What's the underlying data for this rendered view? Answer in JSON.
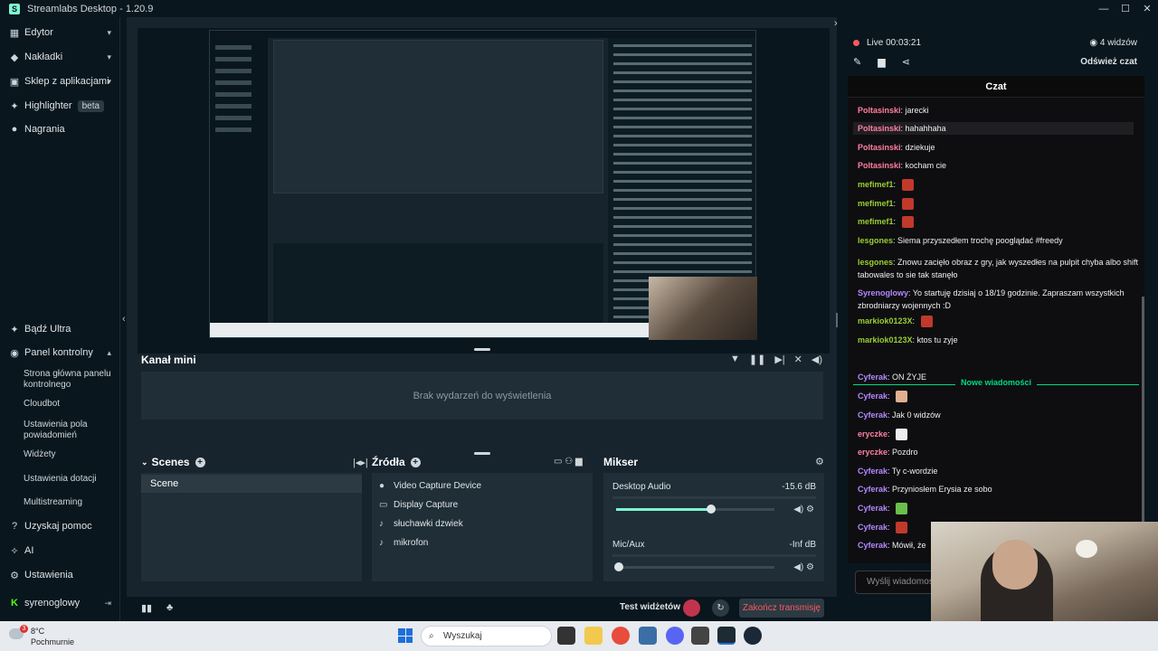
{
  "window": {
    "title": "Streamlabs Desktop - 1.20.9",
    "controls": [
      "—",
      "☐",
      "✕"
    ]
  },
  "sidebar": {
    "items": [
      {
        "label": "Edytor",
        "icon": "layout-icon",
        "glyph": "▦"
      },
      {
        "label": "Nakładki",
        "icon": "overlays-icon",
        "glyph": "◆"
      },
      {
        "label": "Sklep z aplikacjami",
        "icon": "store-icon",
        "glyph": "▣"
      },
      {
        "label": "Highlighter",
        "icon": "highlighter-icon",
        "glyph": "✦",
        "badge": "beta"
      },
      {
        "label": "Nagrania",
        "icon": "recordings-icon",
        "glyph": "●"
      }
    ],
    "ultra": "Bądź Ultra",
    "dashboard": "Panel kontrolny",
    "dashboard_sub": [
      "Strona główna panelu kontrolnego",
      "Cloudbot",
      "Ustawienia pola powiadomień",
      "Widżety",
      "Ustawienia dotacji",
      "Multistreaming"
    ],
    "help": "Uzyskaj pomoc",
    "ai": "AI",
    "settings": "Ustawienia",
    "user": "syrenoglowy"
  },
  "minifeed": {
    "title": "Kanał mini",
    "empty": "Brak wydarzeń do wyświetlenia"
  },
  "scenes": {
    "title": "Scenes",
    "items": [
      "Scene"
    ]
  },
  "sources": {
    "title": "Źródła",
    "items": [
      {
        "label": "Video Capture Device",
        "glyph": "●"
      },
      {
        "label": "Display Capture",
        "glyph": "▭"
      },
      {
        "label": "słuchawki dzwiek",
        "glyph": "♪"
      },
      {
        "label": "mikrofon",
        "glyph": "♪"
      }
    ]
  },
  "mixer": {
    "title": "Mikser",
    "channels": [
      {
        "name": "Desktop Audio",
        "db": "-15.6 dB",
        "level": 0.6
      },
      {
        "name": "Mic/Aux",
        "db": "-Inf dB",
        "level": 0.0
      }
    ]
  },
  "footer": {
    "test_widgets": "Test widżetów",
    "end_stream": "Zakończ transmisję"
  },
  "chatpane": {
    "live": "Live 00:03:21",
    "viewers": "4 widzów",
    "refresh": "Odśwież czat",
    "chat_title": "Czat",
    "input_placeholder": "Wyślij wiadomość",
    "new_messages": "Nowe wiadomości",
    "messages": [
      {
        "user": "Poltasinski",
        "text": "jarecki",
        "color": "#ff7fa0"
      },
      {
        "user": "Poltasinski",
        "text": "hahahhaha",
        "color": "#ff7fa0",
        "highlight": true
      },
      {
        "user": "Poltasinski",
        "text": "dziekuje",
        "color": "#ff7fa0"
      },
      {
        "user": "Poltasinski",
        "text": "kocham cie",
        "color": "#ff7fa0"
      },
      {
        "user": "mefimef1",
        "text": "",
        "color": "#9acd32",
        "emote": "#c0392b"
      },
      {
        "user": "mefimef1",
        "text": "",
        "color": "#9acd32",
        "emote": "#c0392b"
      },
      {
        "user": "mefimef1",
        "text": "",
        "color": "#9acd32",
        "emote": "#c0392b"
      },
      {
        "user": "lesgones",
        "text": "Siema przyszedłem trochę pooglądać #freedy",
        "color": "#9acd32"
      },
      {
        "user": "lesgones",
        "text": "Znowu zacięło obraz z gry, jak wyszedłes na pulpit chyba albo shift tabowales to sie tak stanęło",
        "color": "#9acd32"
      },
      {
        "user": "Syrenoglowy",
        "text": "Yo startuję dzisiaj o 18/19 godzinie. Zapraszam wszystkich zbrodniarzy wojennych :D",
        "color": "#b388ff"
      },
      {
        "user": "markiok0123X",
        "text": "",
        "color": "#9acd32",
        "emote": "#c0392b"
      },
      {
        "user": "markiok0123X",
        "text": "ktos tu zyje",
        "color": "#9acd32"
      },
      {
        "user": "Cyferak",
        "text": "ON ŻYJE",
        "color": "#b388ff"
      },
      {
        "user": "Cyferak",
        "text": "",
        "color": "#b388ff",
        "emote": "#e0b090"
      },
      {
        "user": "Cyferak",
        "text": "Jak 0 widzów",
        "color": "#b388ff"
      },
      {
        "user": "eryczke",
        "text": "",
        "color": "#ff7fa0",
        "emote": "#eeeeee"
      },
      {
        "user": "eryczke",
        "text": "Pozdro",
        "color": "#ff7fa0"
      },
      {
        "user": "Cyferak",
        "text": "Ty c-wordzie",
        "color": "#b388ff"
      },
      {
        "user": "Cyferak",
        "text": "Przyniosłem Erysia ze sobo",
        "color": "#b388ff"
      },
      {
        "user": "Cyferak",
        "text": "",
        "color": "#b388ff",
        "emote": "#6abf4b"
      },
      {
        "user": "Cyferak",
        "text": "",
        "color": "#b388ff",
        "emote": "#c0392b"
      },
      {
        "user": "Cyferak",
        "text": "Mówił, że",
        "color": "#b388ff"
      }
    ]
  },
  "taskbar": {
    "temp": "8°C",
    "condition": "Pochmurnie",
    "notif": "3",
    "search": "Wyszukaj"
  }
}
